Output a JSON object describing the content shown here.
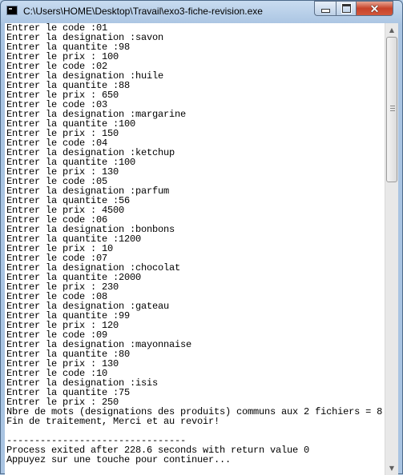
{
  "window": {
    "title": "C:\\Users\\HOME\\Desktop\\Travail\\exo3-fiche-revision.exe",
    "icon": "console-app-icon",
    "controls": {
      "minimize": "minimize-icon",
      "maximize": "maximize-icon",
      "close": "close-icon"
    }
  },
  "console": {
    "lines": [
      "Entrer le code :01",
      "Entrer la designation :savon",
      "Entrer la quantite :98",
      "Entrer le prix : 100",
      "Entrer le code :02",
      "Entrer la designation :huile",
      "Entrer la quantite :88",
      "Entrer le prix : 650",
      "Entrer le code :03",
      "Entrer la designation :margarine",
      "Entrer la quantite :100",
      "Entrer le prix : 150",
      "Entrer le code :04",
      "Entrer la designation :ketchup",
      "Entrer la quantite :100",
      "Entrer le prix : 130",
      "Entrer le code :05",
      "Entrer la designation :parfum",
      "Entrer la quantite :56",
      "Entrer le prix : 4500",
      "Entrer le code :06",
      "Entrer la designation :bonbons",
      "Entrer la quantite :1200",
      "Entrer le prix : 10",
      "Entrer le code :07",
      "Entrer la designation :chocolat",
      "Entrer la quantite :2000",
      "Entrer le prix : 230",
      "Entrer le code :08",
      "Entrer la designation :gateau",
      "Entrer la quantite :99",
      "Entrer le prix : 120",
      "Entrer le code :09",
      "Entrer la designation :mayonnaise",
      "Entrer la quantite :80",
      "Entrer le prix : 130",
      "Entrer le code :10",
      "Entrer la designation :isis",
      "Entrer la quantite :75",
      "Entrer le prix : 250",
      "Nbre de mots (designations des produits) communs aux 2 fichiers = 8",
      "Fin de traitement, Merci et au revoir!",
      "",
      "--------------------------------",
      "Process exited after 228.6 seconds with return value 0",
      "Appuyez sur une touche pour continuer..."
    ]
  },
  "scrollbar": {
    "up_icon": "scroll-up-arrow-icon",
    "down_icon": "scroll-down-arrow-icon"
  }
}
